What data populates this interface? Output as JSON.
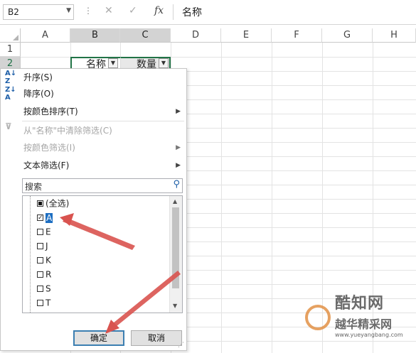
{
  "formula_bar": {
    "name_box": "B2",
    "dots": "⋮",
    "cancel_icon": "✕",
    "enter_icon": "✓",
    "fx_label": "fx",
    "formula_value": "名称"
  },
  "columns": [
    "A",
    "B",
    "C",
    "D",
    "E",
    "F",
    "G",
    "H"
  ],
  "rows": [
    "1",
    "2"
  ],
  "header_cells": {
    "b2": "名称",
    "c2": "数量"
  },
  "sort_filter_menu": {
    "sort_asc": "升序(S)",
    "sort_desc": "降序(O)",
    "sort_by_color": "按颜色排序(T)",
    "clear_filter": "从\"名称\"中清除筛选(C)",
    "filter_by_color": "按颜色筛选(I)",
    "text_filter": "文本筛选(F)",
    "search_placeholder": "搜索",
    "items": [
      {
        "label": "(全选)",
        "state": "partial"
      },
      {
        "label": "A",
        "state": "checked"
      },
      {
        "label": "E",
        "state": "unchecked"
      },
      {
        "label": "J",
        "state": "unchecked"
      },
      {
        "label": "K",
        "state": "unchecked"
      },
      {
        "label": "R",
        "state": "unchecked"
      },
      {
        "label": "S",
        "state": "unchecked"
      },
      {
        "label": "T",
        "state": "unchecked"
      }
    ],
    "ok_button": "确定",
    "cancel_button": "取消"
  },
  "watermark": {
    "brand": "酷知网",
    "sub": "越华精采网",
    "url": "www.yueyangbang.com"
  },
  "colors": {
    "selected_header": "#d3d3d3",
    "highlight": "#1e6fc2",
    "arrow": "#d9534f",
    "accent": "#217346"
  }
}
